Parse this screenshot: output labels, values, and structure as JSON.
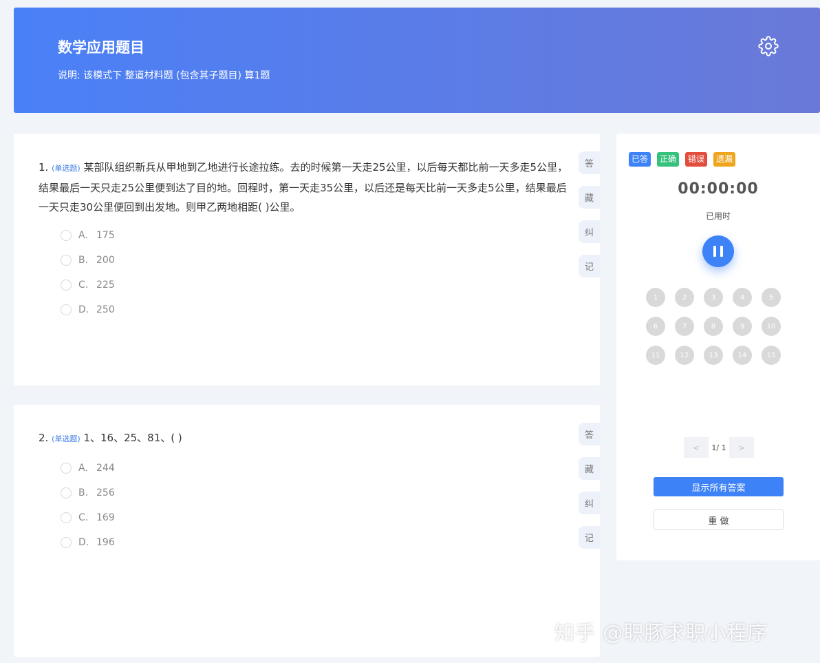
{
  "header": {
    "title": "数学应用题目",
    "description": "说明:   该模式下 整道材料题 (包含其子题目) 算1题",
    "settings_icon": "gear-icon"
  },
  "questions": [
    {
      "number": "1.",
      "type": "(单选题)",
      "text": "某部队组织新兵从甲地到乙地进行长途拉练。去的时候第一天走25公里，以后每天都比前一天多走5公里，结果最后一天只走25公里便到达了目的地。回程时，第一天走35公里，以后还是每天比前一天多走5公里，结果最后一天只走30公里便回到出发地。则甲乙两地相距(        )公里。",
      "options": [
        {
          "letter": "A.",
          "value": "175"
        },
        {
          "letter": "B.",
          "value": "200"
        },
        {
          "letter": "C.",
          "value": "225"
        },
        {
          "letter": "D.",
          "value": "250"
        }
      ],
      "side_tags": [
        "答",
        "藏",
        "纠",
        "记"
      ]
    },
    {
      "number": "2.",
      "type": "(单选题)",
      "text": "1、16、25、81、(        )",
      "options": [
        {
          "letter": "A.",
          "value": "244"
        },
        {
          "letter": "B.",
          "value": "256"
        },
        {
          "letter": "C.",
          "value": "169"
        },
        {
          "letter": "D.",
          "value": "196"
        }
      ],
      "side_tags": [
        "答",
        "藏",
        "纠",
        "记"
      ]
    }
  ],
  "panel": {
    "legend": [
      {
        "label": "已答",
        "color": "#3e82f7"
      },
      {
        "label": "正确",
        "color": "#36c17c"
      },
      {
        "label": "错误",
        "color": "#e34d3d"
      },
      {
        "label": "遗漏",
        "color": "#f0a51f"
      }
    ],
    "timer": "00:00:00",
    "timer_label": "已用时",
    "pause_icon": "pause-icon",
    "numbers": [
      "1",
      "2",
      "3",
      "4",
      "5",
      "6",
      "7",
      "8",
      "9",
      "10",
      "11",
      "12",
      "13",
      "14",
      "15"
    ],
    "pager": {
      "prev": "<",
      "info": "1/ 1",
      "next": ">"
    },
    "show_answers_label": "显示所有答案",
    "redo_label": "重 做"
  },
  "watermark": "知乎 @职豚求职小程序"
}
